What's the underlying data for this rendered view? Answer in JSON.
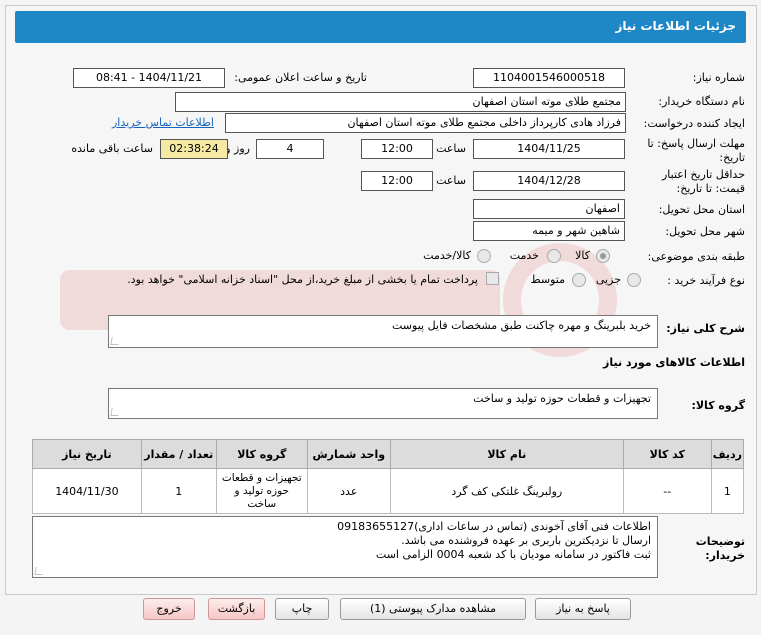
{
  "header": {
    "title": "جزئیات اطلاعات نیاز"
  },
  "fields": {
    "need_number_label": "شماره نیاز:",
    "need_number": "1104001546000518",
    "announce_label": "تاریخ و ساعت اعلان عمومی:",
    "announce_value": "1404/11/21 - 08:41",
    "buyer_org_label": "نام دستگاه خریدار:",
    "buyer_org": "مجتمع طلای موته استان اصفهان",
    "requester_label": "ایجاد کننده درخواست:",
    "requester": "فرزاد هادی کارپرداز داخلی مجتمع طلای موته استان اصفهان",
    "contact_link": "اطلاعات تماس خریدار",
    "deadline_label": "مهلت ارسال پاسخ: تا",
    "deadline_label2": "تاریخ:",
    "deadline_date": "1404/11/25",
    "time_label": "ساعت",
    "deadline_time": "12:00",
    "days_value": "4",
    "days_label": "روز و",
    "remaining_time": "02:38:24",
    "remaining_label": "ساعت باقی مانده",
    "validity_label": "حداقل تاریخ اعتبار",
    "validity_label2": "قیمت: تا تاریخ:",
    "validity_date": "1404/12/28",
    "validity_time": "12:00",
    "province_label": "استان محل تحویل:",
    "province": "اصفهان",
    "city_label": "شهر محل تحویل:",
    "city": "شاهین شهر و میمه",
    "category_label": "طبقه بندی موضوعی:",
    "category_options": [
      "کالا",
      "خدمت",
      "کالا/خدمت"
    ],
    "category_selected": "کالا",
    "process_label": "نوع فرآیند خرید :",
    "process_options": [
      "جزیی",
      "متوسط"
    ],
    "payment_note": "پرداخت تمام یا بخشی از مبلغ خرید،از محل \"اسناد خزانه اسلامی\" خواهد بود."
  },
  "description": {
    "label": "شرح کلی نیاز:",
    "value": "خرید بلبرینگ و مهره چاکنت طبق مشخصات فایل پیوست"
  },
  "goods_section": {
    "title": "اطلاعات کالاهای مورد نیاز"
  },
  "goods_group": {
    "label": "گروه کالا:",
    "value": "تجهیزات و قطعات حوزه تولید و ساخت"
  },
  "table": {
    "headers": [
      "ردیف",
      "کد کالا",
      "نام کالا",
      "واحد شمارش",
      "گروه کالا",
      "تعداد / مقدار",
      "تاریخ نیاز"
    ],
    "rows": [
      [
        "1",
        "--",
        "رولبرینگ غلتکی کف گرد",
        "عدد",
        "تجهیزات و قطعات حوزه تولید و ساخت",
        "1",
        "1404/11/30"
      ]
    ]
  },
  "buyer_notes": {
    "label1": "توضیحات",
    "label2": "خریدار:",
    "lines": [
      "اطلاعات فنی آقای آخوندی (تماس در ساعات اداری)09183655127",
      "ارسال تا نزدیکترین باربری بر عهده فروشنده می باشد.",
      "ثبت فاکتور در سامانه مودیان با کد شعبه 0004 الزامی است"
    ]
  },
  "buttons": {
    "reply": "پاسخ به نیاز",
    "docs": "مشاهده مدارک پیوستی (1)",
    "print": "چاپ",
    "back": "بازگشت",
    "exit": "خروج"
  },
  "colors": {
    "header": "#1e88c7",
    "highlight": "#f6e9a3",
    "link": "#1565c0"
  }
}
